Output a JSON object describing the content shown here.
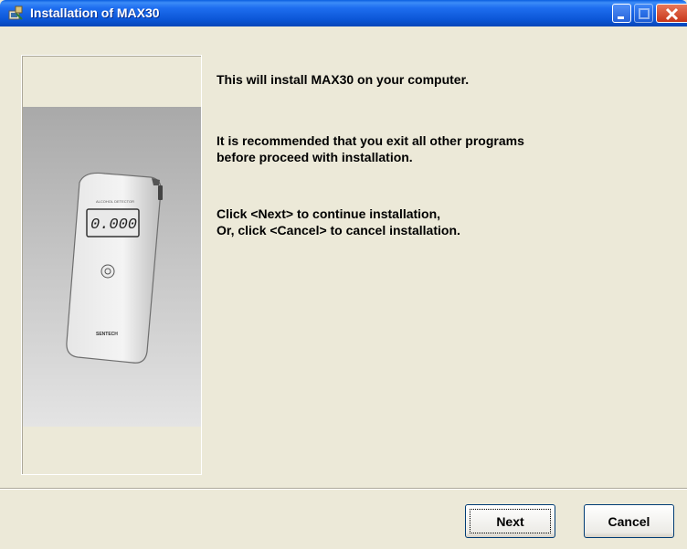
{
  "window": {
    "title": "Installation of MAX30",
    "controls": [
      "minimize",
      "maximize",
      "close"
    ]
  },
  "side_image": {
    "display_reading": "0.000",
    "device_brand": "SENTECH",
    "device_label": "ALCOHOL DETECTOR"
  },
  "messages": {
    "line1": "This will install MAX30 on your computer.",
    "line2": "It is recommended that you exit all other programs",
    "line3": "before proceed with installation.",
    "line4": "Click <Next> to continue installation,",
    "line5": "Or, click <Cancel> to cancel installation."
  },
  "buttons": {
    "next": "Next",
    "cancel": "Cancel"
  },
  "colors": {
    "titlebar": "#0B55D6",
    "dialog_bg": "#ECE9D8",
    "close_button": "#C7361A"
  }
}
